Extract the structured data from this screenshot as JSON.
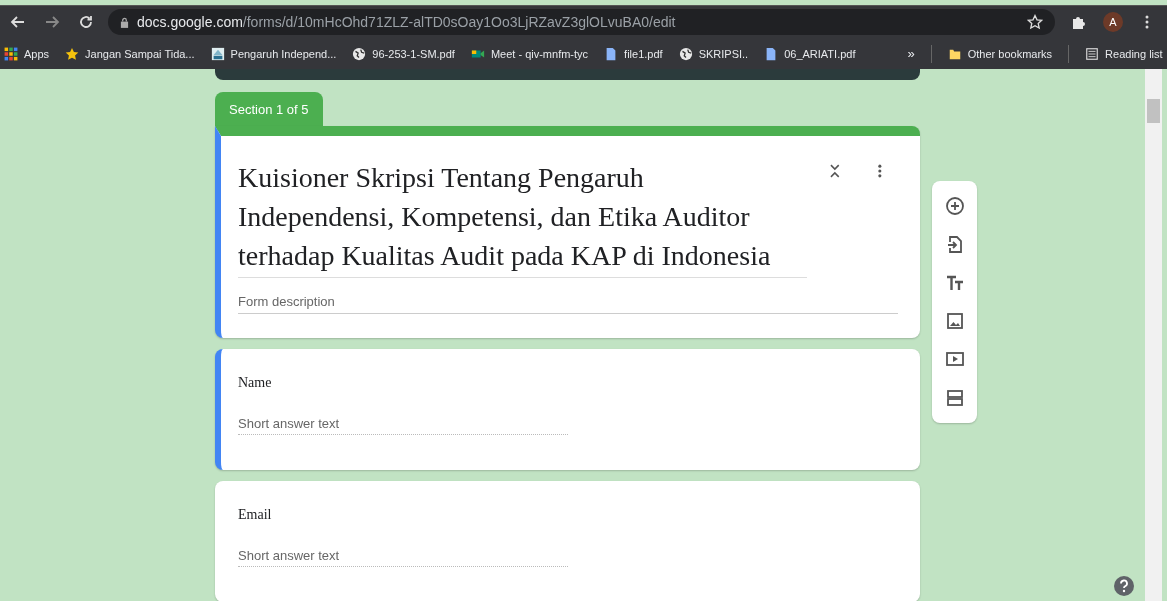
{
  "browser": {
    "url_host": "docs.google.com",
    "url_path": "/forms/d/10mHcOhd71ZLZ-alTD0sOay1Oo3LjRZavZ3glOLvuBA0/edit",
    "profile_initial": "A"
  },
  "bookmarks": [
    {
      "label": "Apps",
      "kind": "apps"
    },
    {
      "label": "Jangan Sampai Tida...",
      "kind": "star"
    },
    {
      "label": "Pengaruh Independ...",
      "kind": "site"
    },
    {
      "label": "96-253-1-SM.pdf",
      "kind": "globe"
    },
    {
      "label": "Meet - qiv-mnfm-tyc",
      "kind": "meet"
    },
    {
      "label": "file1.pdf",
      "kind": "doc"
    },
    {
      "label": "SKRIPSI..",
      "kind": "globe"
    },
    {
      "label": "06_ARIATI.pdf",
      "kind": "doc"
    }
  ],
  "bookmarks_overflow": "»",
  "other_bookmarks": "Other bookmarks",
  "reading_list": "Reading list",
  "section_tab": "Section 1 of 5",
  "form": {
    "title": "Kuisioner Skripsi Tentang Pengaruh Independensi, Kompetensi, dan Etika Auditor terhadap Kualitas Audit pada KAP di Indonesia",
    "description_placeholder": "Form description",
    "selected": true
  },
  "questions": [
    {
      "title": "Name",
      "placeholder": "Short answer text",
      "selected": true
    },
    {
      "title": "Email",
      "placeholder": "Short answer text",
      "selected": false
    }
  ]
}
